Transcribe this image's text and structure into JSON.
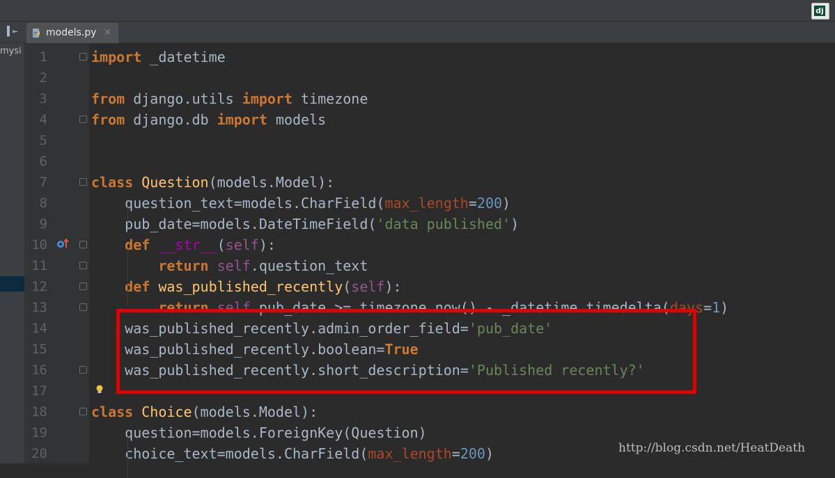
{
  "tabs": [
    {
      "label": "models.py",
      "close": "×",
      "icon": "python-file-icon"
    }
  ],
  "toolbar": {
    "tool_glyph": "▌⇤",
    "badge": "dj",
    "badge_icon": "django-icon"
  },
  "project_panel": {
    "label": "mysi"
  },
  "watermark": "http://blog.csdn.net/HeatDeath",
  "colors": {
    "keyword": "#cc7832",
    "string": "#6a8759",
    "number": "#6897bb",
    "self": "#94558d",
    "highlight_box": "#e00000"
  },
  "code": [
    {
      "n": "1",
      "t": [
        [
          "kw",
          "import"
        ],
        [
          "id",
          " _datetime"
        ]
      ]
    },
    {
      "n": "2",
      "t": []
    },
    {
      "n": "3",
      "t": [
        [
          "kw",
          "from"
        ],
        [
          "id",
          " django.utils "
        ],
        [
          "kw",
          "import"
        ],
        [
          "id",
          " timezone"
        ]
      ]
    },
    {
      "n": "4",
      "t": [
        [
          "kw",
          "from"
        ],
        [
          "id",
          " django.db "
        ],
        [
          "kw",
          "import"
        ],
        [
          "id",
          " models"
        ]
      ]
    },
    {
      "n": "5",
      "t": []
    },
    {
      "n": "6",
      "t": []
    },
    {
      "n": "7",
      "t": [
        [
          "kw",
          "class"
        ],
        [
          "id",
          " "
        ],
        [
          "fn",
          "Question"
        ],
        [
          "id",
          "(models.Model):"
        ]
      ]
    },
    {
      "n": "8",
      "t": [
        [
          "id",
          "    question_text=models.CharField("
        ],
        [
          "prm",
          "max_length"
        ],
        [
          "id",
          "="
        ],
        [
          "num",
          "200"
        ],
        [
          "id",
          ")"
        ]
      ]
    },
    {
      "n": "9",
      "t": [
        [
          "id",
          "    pub_date=models.DateTimeField("
        ],
        [
          "str",
          "'data published'"
        ],
        [
          "id",
          ")"
        ]
      ]
    },
    {
      "n": "10",
      "t": [
        [
          "id",
          "    "
        ],
        [
          "kw",
          "def"
        ],
        [
          "id",
          " "
        ],
        [
          "magic",
          "__str__"
        ],
        [
          "id",
          "("
        ],
        [
          "sf",
          "self"
        ],
        [
          "id",
          "):"
        ]
      ]
    },
    {
      "n": "11",
      "t": [
        [
          "id",
          "        "
        ],
        [
          "kw",
          "return"
        ],
        [
          "id",
          " "
        ],
        [
          "sf",
          "self"
        ],
        [
          "id",
          ".question_text"
        ]
      ]
    },
    {
      "n": "12",
      "t": [
        [
          "id",
          "    "
        ],
        [
          "kw",
          "def"
        ],
        [
          "id",
          " "
        ],
        [
          "fn",
          "was_published_recently"
        ],
        [
          "id",
          "("
        ],
        [
          "sf",
          "self"
        ],
        [
          "id",
          "):"
        ]
      ]
    },
    {
      "n": "13",
      "t": [
        [
          "id",
          "        "
        ],
        [
          "kw",
          "return"
        ],
        [
          "id",
          " "
        ],
        [
          "sf",
          "self"
        ],
        [
          "id",
          ".pub_date >= timezone.now() - _datetime.timedelta("
        ],
        [
          "prm",
          "days"
        ],
        [
          "id",
          "="
        ],
        [
          "num",
          "1"
        ],
        [
          "id",
          ")"
        ]
      ]
    },
    {
      "n": "14",
      "t": [
        [
          "id",
          "    was_published_recently.admin_order_field="
        ],
        [
          "str",
          "'pub_date'"
        ]
      ]
    },
    {
      "n": "15",
      "t": [
        [
          "id",
          "    was_published_recently.boolean="
        ],
        [
          "kw",
          "True"
        ]
      ]
    },
    {
      "n": "16",
      "t": [
        [
          "id",
          "    was_published_recently.short_description="
        ],
        [
          "str",
          "'Published recently?'"
        ]
      ]
    },
    {
      "n": "17",
      "t": []
    },
    {
      "n": "18",
      "t": [
        [
          "kw",
          "class"
        ],
        [
          "id",
          " "
        ],
        [
          "fn",
          "Choice"
        ],
        [
          "id",
          "(models.Model):"
        ]
      ]
    },
    {
      "n": "19",
      "t": [
        [
          "id",
          "    question=models.ForeignKey(Question)"
        ]
      ]
    },
    {
      "n": "20",
      "t": [
        [
          "id",
          "    choice_text=models.CharField("
        ],
        [
          "prm",
          "max_length"
        ],
        [
          "id",
          "="
        ],
        [
          "num",
          "200"
        ],
        [
          "id",
          ")"
        ]
      ]
    }
  ]
}
